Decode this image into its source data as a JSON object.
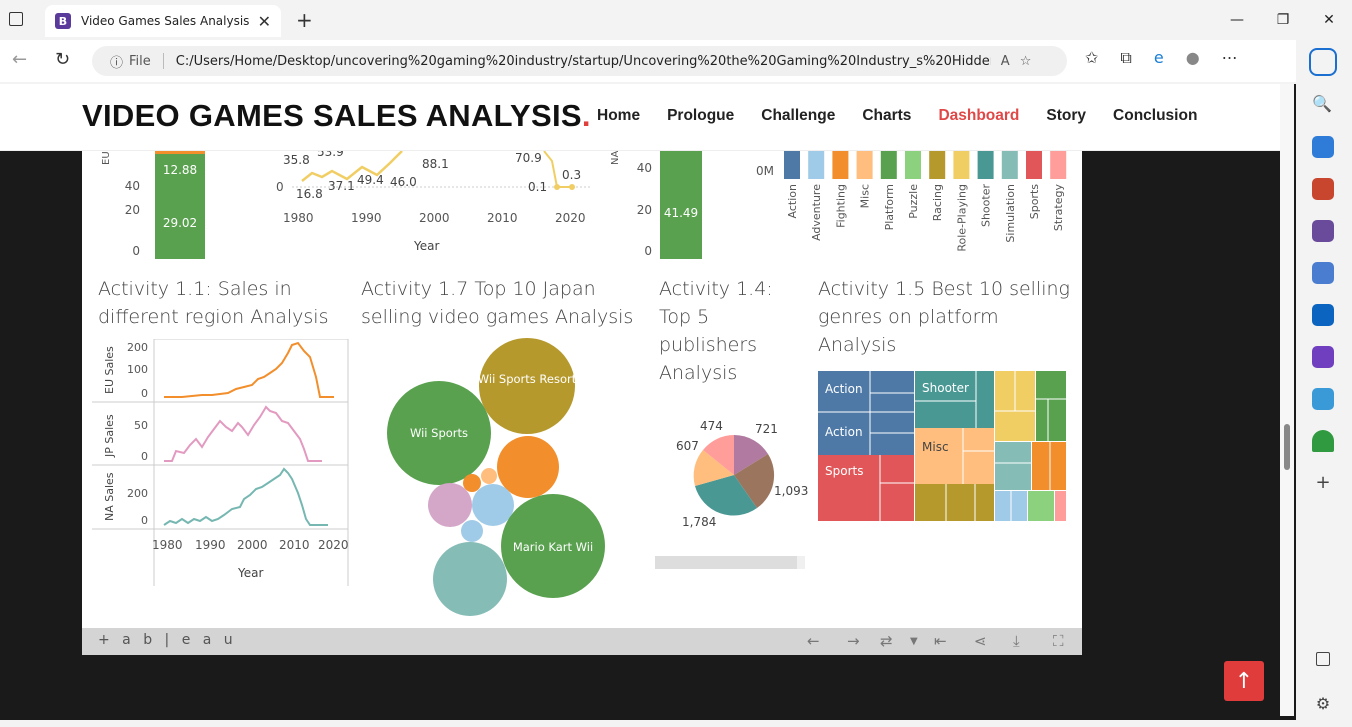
{
  "browser": {
    "tab_title": "Video Games Sales Analysis",
    "favicon_letter": "B",
    "url_prefix": "File",
    "url": "C:/Users/Home/Desktop/uncovering%20gaming%20industry/startup/Uncovering%20the%20Gaming%20Industry_s%20Hidden%2..."
  },
  "site": {
    "brand": "VIDEO GAMES SALES ANALYSIS",
    "brand_dot": ".",
    "nav": [
      "Home",
      "Prologue",
      "Challenge",
      "Charts",
      "Dashboard",
      "Story",
      "Conclusion"
    ],
    "active_nav": "Dashboard"
  },
  "dashboard": {
    "top_left": {
      "axis_label": "EU",
      "ticks": [
        "40",
        "20",
        "0"
      ],
      "bar_labels": [
        "12.88",
        "29.02"
      ]
    },
    "top_line": {
      "labels": [
        "35.8",
        "53.9",
        "16.8",
        "37.1",
        "49.4",
        "46.0",
        "88.1",
        "70.9",
        "0.1",
        "0.3"
      ],
      "y_tick": "0",
      "x_ticks": [
        "1980",
        "1990",
        "2000",
        "2010",
        "2020"
      ],
      "xlabel": "Year"
    },
    "top_na": {
      "axis_label": "NA",
      "ticks": [
        "40",
        "20",
        "0"
      ],
      "bar_labels": [
        "41.49"
      ]
    },
    "top_genre": {
      "zero_label": "0M",
      "genres": [
        "Action",
        "Adventure",
        "Fighting",
        "Misc",
        "Platform",
        "Puzzle",
        "Racing",
        "Role-Playing",
        "Shooter",
        "Simulation",
        "Sports",
        "Strategy"
      ],
      "colors": [
        "#4e79a7",
        "#a0cbe8",
        "#f28e2b",
        "#ffbe7d",
        "#59a14f",
        "#8cd17d",
        "#b6992d",
        "#f1ce63",
        "#499894",
        "#86bcb6",
        "#e15759",
        "#ff9d9a"
      ]
    },
    "activity_1_1": {
      "title": "Activity 1.1: Sales in different region Analysis",
      "rows": [
        {
          "label": "EU Sales",
          "ticks": [
            "200",
            "100",
            "0"
          ],
          "color": "#f28e2b"
        },
        {
          "label": "JP Sales",
          "ticks": [
            "50",
            "0"
          ],
          "color": "#e39ac0"
        },
        {
          "label": "NA Sales",
          "ticks": [
            "200",
            "0"
          ],
          "color": "#76b7b2"
        }
      ],
      "x_ticks": [
        "1980",
        "1990",
        "2000",
        "2010",
        "2020"
      ],
      "xlabel": "Year"
    },
    "activity_1_7": {
      "title": "Activity 1.7 Top 10 Japan selling video games Analysis",
      "bubbles": [
        "Wii Sports Resort",
        "Wii Sports",
        "Mario Kart Wii"
      ]
    },
    "activity_1_4": {
      "title": "Activity 1.4: Top 5 publishers Analysis",
      "pie_labels": [
        "474",
        "721",
        "607",
        "1,093",
        "1,784"
      ]
    },
    "activity_1_5": {
      "title": "Activity 1.5 Best 10 selling genres on platform Analysis",
      "tiles": [
        "Action",
        "Action",
        "Shooter",
        "Misc",
        "Sports"
      ]
    }
  },
  "footer": {
    "logo": "+ a b | e a u"
  }
}
